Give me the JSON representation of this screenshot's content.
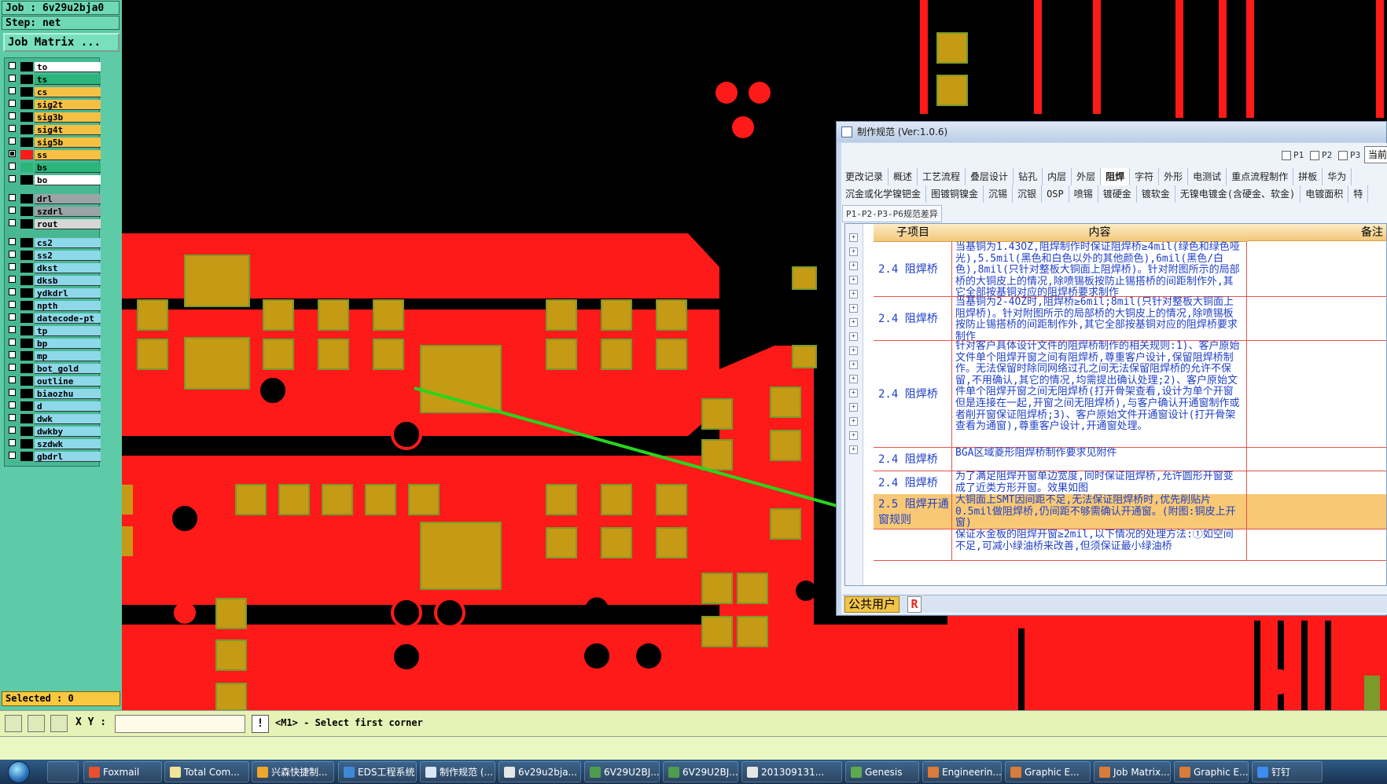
{
  "app": {
    "job_line": "Job : 6v29u2bja0",
    "step_line": "Step: net",
    "job_matrix_button": "Job Matrix ..."
  },
  "layers": [
    {
      "name": "to",
      "color": "#ffffff",
      "swatch": "#000000",
      "checked": false
    },
    {
      "name": "ts",
      "color": "#2bb57a",
      "swatch": "#000000",
      "checked": false
    },
    {
      "name": "cs",
      "color": "#f5c043",
      "swatch": "#000000",
      "checked": false
    },
    {
      "name": "sig2t",
      "color": "#f5c043",
      "swatch": "#000000",
      "checked": false
    },
    {
      "name": "sig3b",
      "color": "#f5c043",
      "swatch": "#000000",
      "checked": false
    },
    {
      "name": "sig4t",
      "color": "#f5c043",
      "swatch": "#000000",
      "checked": false
    },
    {
      "name": "sig5b",
      "color": "#f5c043",
      "swatch": "#000000",
      "checked": false
    },
    {
      "name": "ss",
      "color": "#f5c043",
      "swatch": "#ff1a1a",
      "checked": true
    },
    {
      "name": "bs",
      "color": "#2bb57a",
      "swatch": "#2bb57a",
      "checked": false
    },
    {
      "name": "bo",
      "color": "#ffffff",
      "swatch": "#000000",
      "checked": false
    },
    {
      "name": "drl",
      "color": "#9aa4a6",
      "swatch": "#000000",
      "checked": false
    },
    {
      "name": "szdrl",
      "color": "#9aa4a6",
      "swatch": "#000000",
      "checked": false
    },
    {
      "name": "rout",
      "color": "#d7d7d7",
      "swatch": "#000000",
      "checked": false
    },
    {
      "name": "cs2",
      "color": "#8ed8ea",
      "swatch": "#000000",
      "checked": false
    },
    {
      "name": "ss2",
      "color": "#8ed8ea",
      "swatch": "#000000",
      "checked": false
    },
    {
      "name": "dkst",
      "color": "#8ed8ea",
      "swatch": "#000000",
      "checked": false
    },
    {
      "name": "dksb",
      "color": "#8ed8ea",
      "swatch": "#000000",
      "checked": false
    },
    {
      "name": "ydkdrl",
      "color": "#8ed8ea",
      "swatch": "#000000",
      "checked": false
    },
    {
      "name": "npth",
      "color": "#8ed8ea",
      "swatch": "#000000",
      "checked": false
    },
    {
      "name": "datecode-pt",
      "color": "#8ed8ea",
      "swatch": "#000000",
      "checked": false
    },
    {
      "name": "tp",
      "color": "#8ed8ea",
      "swatch": "#000000",
      "checked": false
    },
    {
      "name": "bp",
      "color": "#8ed8ea",
      "swatch": "#000000",
      "checked": false
    },
    {
      "name": "mp",
      "color": "#8ed8ea",
      "swatch": "#000000",
      "checked": false
    },
    {
      "name": "bot_gold",
      "color": "#8ed8ea",
      "swatch": "#000000",
      "checked": false
    },
    {
      "name": "outline",
      "color": "#8ed8ea",
      "swatch": "#000000",
      "checked": false
    },
    {
      "name": "biaozhu",
      "color": "#8ed8ea",
      "swatch": "#000000",
      "checked": false
    },
    {
      "name": "d",
      "color": "#8ed8ea",
      "swatch": "#000000",
      "checked": false
    },
    {
      "name": "dwk",
      "color": "#8ed8ea",
      "swatch": "#000000",
      "checked": false
    },
    {
      "name": "dwkby",
      "color": "#8ed8ea",
      "swatch": "#000000",
      "checked": false
    },
    {
      "name": "szdwk",
      "color": "#8ed8ea",
      "swatch": "#000000",
      "checked": false
    },
    {
      "name": "gbdrl",
      "color": "#8ed8ea",
      "swatch": "#000000",
      "checked": false
    }
  ],
  "selected_text": "Selected : 0",
  "popup": {
    "title": "制作规范 (Ver:1.0.6)",
    "checks": [
      "P1",
      "P2",
      "P3"
    ],
    "current_button": "当前",
    "tabs_row1": [
      "更改记录",
      "概述",
      "工艺流程",
      "叠层设计",
      "钻孔",
      "内层",
      "外层",
      "阻焊",
      "字符",
      "外形",
      "电测试",
      "重点流程制作",
      "拼板",
      "华为"
    ],
    "tabs_row1_active": "阻焊",
    "tabs_row2": [
      "沉金或化学镍钯金",
      "图镀铜镍金",
      "沉锡",
      "沉银",
      "OSP",
      "喷锡",
      "镀硬金",
      "镀软金",
      "无镍电镀金(含硬金、软金)",
      "电镀面积",
      "特"
    ],
    "diff_label": "P1-P2-P3-P6规范差异",
    "columns": {
      "sub": "子项目",
      "content": "内容",
      "note": "备注"
    },
    "rows": [
      {
        "sub": "2.4 阻焊桥",
        "content": "当基铜为1.43OZ,阻焊制作时保证阻焊桥≥4mil(绿色和绿色哑光),5.5mil(黑色和白色以外的其他颜色),6mil(黑色/白色),8mil(只针对整板大铜面上阻焊桥)。针对附图所示的局部桥的大铜皮上的情况,除喷锡板按防止锡搭桥的间距制作外,其它全部按基铜对应的阻焊桥要求制作"
      },
      {
        "sub": "2.4 阻焊桥",
        "content": "当基铜为2-4OZ时,阻焊桥≥6mil;8mil(只针对整板大铜面上阻焊桥)。针对附图所示的局部桥的大铜皮上的情况,除喷锡板按防止锡搭桥的间距制作外,其它全部按基铜对应的阻焊桥要求制作"
      },
      {
        "sub": "2.4 阻焊桥",
        "content": "针对客户具体设计文件的阻焊桥制作的相关规则:1)、客户原始文件单个阻焊开窗之间有阻焊桥,尊重客户设计,保留阻焊桥制作。无法保留时除同网络过孔之间无法保留阻焊桥的允许不保留,不用确认,其它的情况,均需提出确认处理;2)、客户原始文件单个阻焊开窗之间无阻焊桥(打开骨架查看,设计为单个开窗但是连接在一起,开窗之间无阻焊桥),与客户确认开通窗制作或者削开窗保证阻焊桥;3)、客户原始文件开通窗设计(打开骨架查看为通窗),尊重客户设计,开通窗处理。"
      },
      {
        "sub": "2.4 阻焊桥",
        "content": "BGA区域菱形阻焊桥制作要求见附件"
      },
      {
        "sub": "2.4 阻焊桥",
        "content": "为了满足阻焊开窗单边宽度,同时保证阻焊桥,允许圆形开窗变成了近类方形开窗。效果如图"
      },
      {
        "sub": "2.5 阻焊开通窗规则",
        "content": "大铜面上SMT因间距不足,无法保证阻焊桥时,优先削贴片0.5mil做阻焊桥,仍间距不够需确认开通窗。(附图:铜皮上开窗)",
        "selected": true
      },
      {
        "sub": "",
        "content": "保证水金板的阻焊开窗≥2mil,以下情况的处理方法:①如空间不足,可减小绿油桥来改善,但须保证最小绿油桥"
      }
    ],
    "footer_user": "公共用户",
    "footer_r": "R"
  },
  "command": {
    "xy_label": "X Y :",
    "xy_value": "",
    "message_icon": "!",
    "message": "<M1> - Select first corner"
  },
  "taskbar": [
    {
      "label": "Foxmail",
      "icon_color": "#e8512c"
    },
    {
      "label": "Total Com...",
      "icon_color": "#f2e39a"
    },
    {
      "label": "兴森快捷制...",
      "icon_color": "#f0a62a"
    },
    {
      "label": "EDS工程系统",
      "icon_color": "#3f88d6"
    },
    {
      "label": "制作规范 (...",
      "icon_color": "#d8e6f6"
    },
    {
      "label": "6v29u2bja...",
      "icon_color": "#e6e6e6"
    },
    {
      "label": "6V29U2BJ...",
      "icon_color": "#4f9c4f"
    },
    {
      "label": "6V29U2BJ...",
      "icon_color": "#4f9c4f"
    },
    {
      "label": "201309131...",
      "icon_color": "#e6e6e6"
    },
    {
      "label": "Genesis",
      "icon_color": "#5fa84f"
    },
    {
      "label": "Engineerin...",
      "icon_color": "#d97b3a"
    },
    {
      "label": "Graphic E...",
      "icon_color": "#d97b3a"
    },
    {
      "label": "Job Matrix...",
      "icon_color": "#d97b3a"
    },
    {
      "label": "Graphic E...",
      "icon_color": "#d97b3a"
    },
    {
      "label": "钉钉",
      "icon_color": "#3d8cf0"
    }
  ]
}
